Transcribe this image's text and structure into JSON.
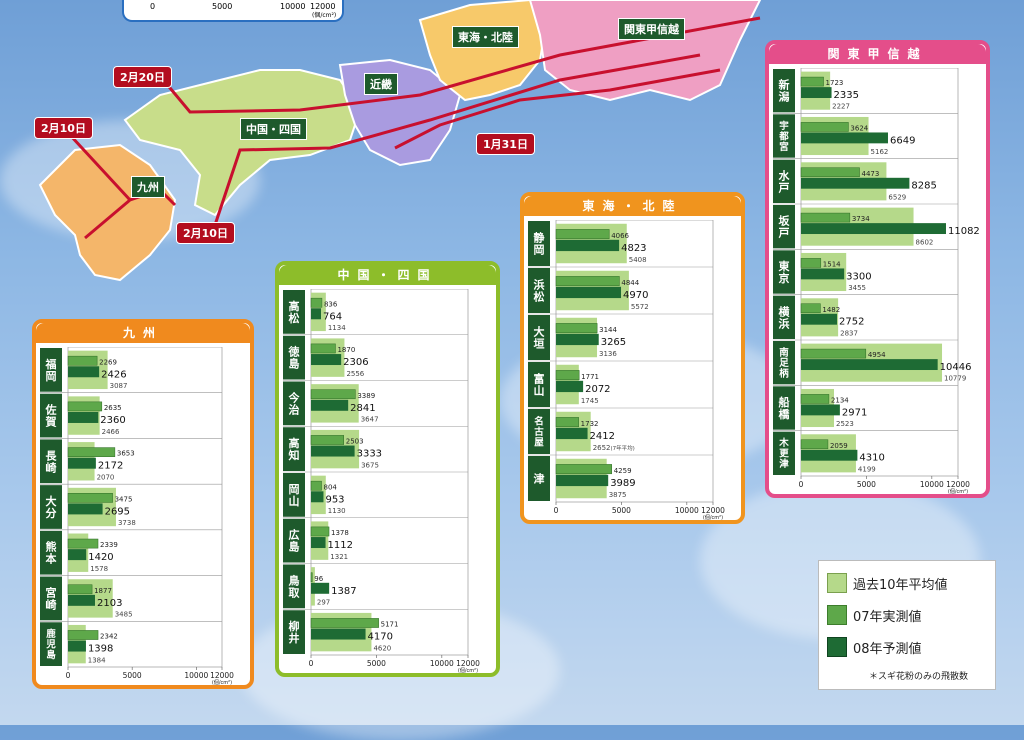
{
  "map": {
    "regions": [
      "九州",
      "中国・四国",
      "近畿",
      "東海・北陸",
      "関東甲信越"
    ],
    "dates": [
      "2月20日",
      "2月10日",
      "2月10日",
      "1月31日"
    ],
    "top_axis": [
      "0",
      "5000",
      "10000",
      "12000",
      "(個/cm²)"
    ]
  },
  "legend": {
    "items": [
      "過去10年平均値",
      "07年実測値",
      "08年予測値"
    ],
    "colors": [
      "#b5d98a",
      "#5ea84a",
      "#1e6b34"
    ],
    "note": "＊スギ花粉のみの飛散数"
  },
  "colors": {
    "kyushu": "#f08a1e",
    "chugoku": "#8dbd2a",
    "tokai": "#f0941e",
    "kanto": "#e44e8a",
    "label_red": "#b30d1f"
  },
  "chart_data": [
    {
      "type": "bar",
      "title": "九州",
      "orientation": "horizontal",
      "categories": [
        "福岡",
        "佐賀",
        "長崎",
        "大分",
        "熊本",
        "宮崎",
        "鹿児島"
      ],
      "series": [
        {
          "name": "07年実測値",
          "values": [
            2269,
            2635,
            3653,
            3475,
            2339,
            1877,
            2342
          ]
        },
        {
          "name": "08年予測値",
          "values": [
            2426,
            2360,
            2172,
            2695,
            1420,
            2103,
            1398
          ]
        },
        {
          "name": "過去10年平均値",
          "values": [
            3087,
            2466,
            2070,
            3738,
            1578,
            3485,
            1384
          ]
        }
      ],
      "xticks": [
        "0",
        "5000",
        "10000",
        "12000"
      ],
      "unit": "(個/cm²)",
      "xlim": [
        0,
        12000
      ]
    },
    {
      "type": "bar",
      "title": "中国・四国",
      "orientation": "horizontal",
      "categories": [
        "高松",
        "徳島",
        "今治",
        "高知",
        "岡山",
        "広島",
        "鳥取",
        "柳井"
      ],
      "series": [
        {
          "name": "07年実測値",
          "values": [
            836,
            1870,
            3389,
            2503,
            804,
            1378,
            96,
            5171
          ]
        },
        {
          "name": "08年予測値",
          "values": [
            764,
            2306,
            2841,
            3333,
            953,
            1112,
            1387,
            4170
          ]
        },
        {
          "name": "過去10年平均値",
          "values": [
            1134,
            2556,
            3647,
            3675,
            1130,
            1321,
            297,
            4620
          ]
        }
      ],
      "xticks": [
        "0",
        "5000",
        "10000",
        "12000"
      ],
      "unit": "(個/cm²)",
      "xlim": [
        0,
        12000
      ]
    },
    {
      "type": "bar",
      "title": "東海・北陸",
      "orientation": "horizontal",
      "categories": [
        "静岡",
        "浜松",
        "大垣",
        "富山",
        "名古屋",
        "津"
      ],
      "series": [
        {
          "name": "07年実測値",
          "values": [
            4066,
            4844,
            3144,
            1771,
            1732,
            4259
          ]
        },
        {
          "name": "08年予測値",
          "values": [
            4823,
            4970,
            3265,
            2072,
            2412,
            3989
          ]
        },
        {
          "name": "過去10年平均値",
          "values": [
            5408,
            5572,
            3136,
            1745,
            2652,
            3875
          ]
        }
      ],
      "avg_notes": [
        "",
        "",
        "",
        "",
        "(7年平均)",
        ""
      ],
      "xticks": [
        "0",
        "5000",
        "10000",
        "12000"
      ],
      "unit": "(個/cm²)",
      "xlim": [
        0,
        12000
      ]
    },
    {
      "type": "bar",
      "title": "関東甲信越",
      "orientation": "horizontal",
      "categories": [
        "新潟",
        "宇都宮",
        "水戸",
        "坂戸",
        "東京",
        "横浜",
        "南足柄",
        "船橋",
        "木更津"
      ],
      "series": [
        {
          "name": "07年実測値",
          "values": [
            1723,
            3624,
            4473,
            3734,
            1514,
            1482,
            4954,
            2134,
            2059
          ]
        },
        {
          "name": "08年予測値",
          "values": [
            2335,
            6649,
            8285,
            11082,
            3300,
            2752,
            10446,
            2971,
            4310
          ]
        },
        {
          "name": "過去10年平均値",
          "values": [
            2227,
            5162,
            6529,
            8602,
            3455,
            2837,
            10779,
            2523,
            4199
          ]
        }
      ],
      "xticks": [
        "0",
        "5000",
        "10000",
        "12000"
      ],
      "unit": "(個/cm²)",
      "xlim": [
        0,
        12000
      ]
    }
  ]
}
